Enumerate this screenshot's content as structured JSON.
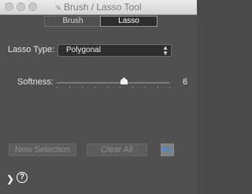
{
  "window": {
    "title": "Brush / Lasso Tool",
    "app_icon": "tool-icon"
  },
  "mode_tabs": [
    {
      "label": "Brush",
      "selected": false
    },
    {
      "label": "Lasso",
      "selected": true
    }
  ],
  "lasso_type": {
    "label": "Lasso Type:",
    "value": "Polygonal"
  },
  "softness": {
    "label": "Softness:",
    "value": "6"
  },
  "buttons": {
    "new_selection": "New Selection",
    "clear_all": "Clear All",
    "undo_icon": "undo-arrow-icon"
  },
  "footer": {
    "expand_icon": "chevron-right-icon",
    "help_icon": "help-icon",
    "help_glyph": "?"
  },
  "colors": {
    "panel_bg": "#505050",
    "undo_accent": "#4a8fd8"
  }
}
